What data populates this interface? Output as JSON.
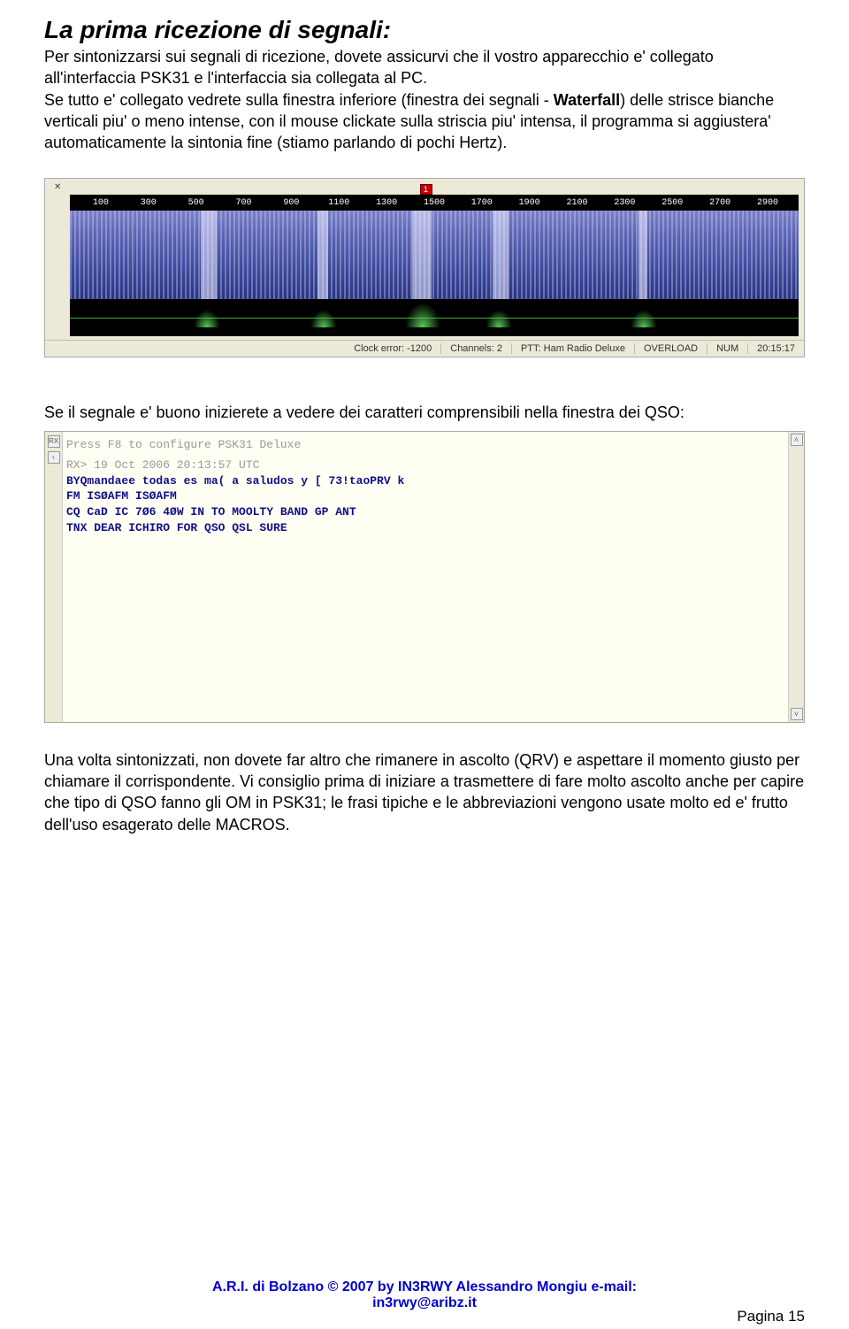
{
  "title": "La prima ricezione di segnali:",
  "p1": "Per sintonizzarsi sui segnali di ricezione, dovete assicurvi che il vostro apparecchio e' collegato all'interfaccia PSK31 e l'interfaccia sia collegata al PC.",
  "p2a": "Se tutto e' collegato vedrete sulla finestra inferiore (finestra dei segnali - ",
  "p2b": "Waterfall",
  "p2c": ") delle strisce bianche verticali piu' o meno intense, con il mouse clickate sulla striscia piu' intensa, il programma si aggiustera' automaticamente la sintonia fine (stiamo parlando di pochi Hertz).",
  "waterfall": {
    "ticks": [
      "100",
      "300",
      "500",
      "700",
      "900",
      "1100",
      "1300",
      "1500",
      "1700",
      "1900",
      "2100",
      "2300",
      "2500",
      "2700",
      "2900"
    ],
    "marker": "1",
    "status": {
      "clock": "Clock error: -1200",
      "channels": "Channels: 2",
      "ptt": "PTT: Ham Radio Deluxe",
      "overload": "OVERLOAD",
      "num": "NUM",
      "time": "20:15:17"
    }
  },
  "p3": "Se il segnale e' buono inizierete a vedere dei caratteri comprensibili nella finestra dei QSO:",
  "qso": {
    "hint": "Press F8 to configure PSK31 Deluxe",
    "rxts": "RX> 19 Oct 2006 20:13:57 UTC",
    "lines": [
      "BYQmandaee todas es ma( a saludos y [ 73!taoPRV k",
      "FM ISØAFM ISØAFM",
      "CQ CaD IC 7Ø6 4ØW IN TO MOOLTY BAND GP ANT",
      "TNX DEAR ICHIRO FOR QSO QSL SURE"
    ]
  },
  "p4": "Una volta sintonizzati, non dovete far altro che rimanere in ascolto (QRV) e aspettare il momento giusto per chiamare il corrispondente. Vi consiglio prima di iniziare a trasmettere di fare molto ascolto anche per capire che tipo di QSO fanno gli OM in PSK31; le frasi tipiche e le abbreviazioni vengono usate molto ed e' frutto dell'uso esagerato delle MACROS.",
  "footer": {
    "line1": "A.R.I. di Bolzano © 2007 by IN3RWY Alessandro Mongiu  e-mail:",
    "line2": "in3rwy@aribz.it"
  },
  "pagenum_label": "Pagina ",
  "pagenum": "15"
}
